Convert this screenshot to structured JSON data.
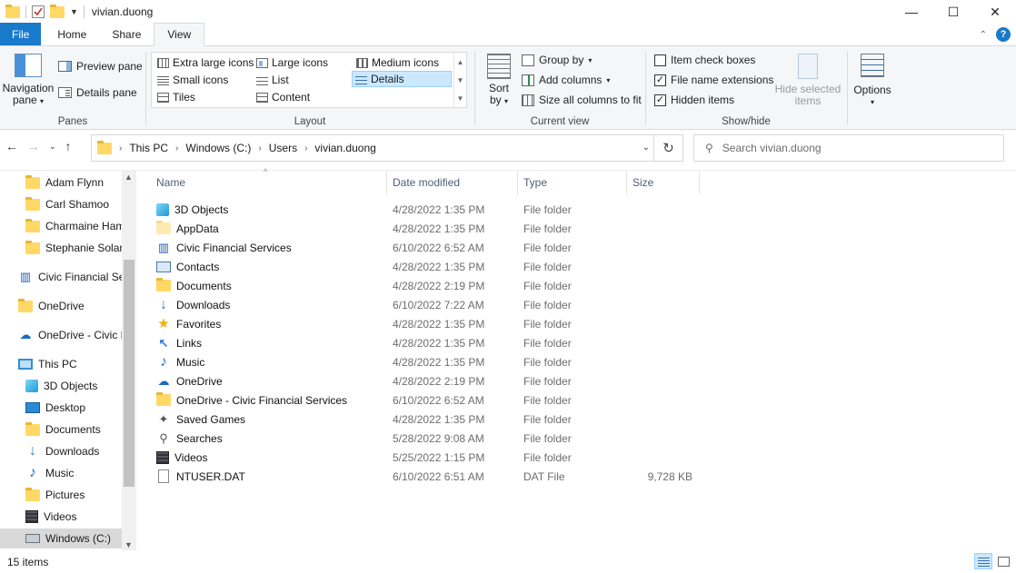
{
  "window": {
    "title": "vivian.duong",
    "minimize": "—",
    "maximize": "☐",
    "close": "✕"
  },
  "tabs": [
    {
      "label": "File"
    },
    {
      "label": "Home"
    },
    {
      "label": "Share"
    },
    {
      "label": "View"
    }
  ],
  "ribbon": {
    "panes": {
      "navigation_pane": "Navigation",
      "navigation_pane_2": "pane",
      "preview_pane": "Preview pane",
      "details_pane": "Details pane",
      "label": "Panes"
    },
    "layout": {
      "extra_large_icons": "Extra large icons",
      "large_icons": "Large icons",
      "medium_icons": "Medium icons",
      "small_icons": "Small icons",
      "list": "List",
      "details": "Details",
      "tiles": "Tiles",
      "content": "Content",
      "label": "Layout"
    },
    "current_view": {
      "sort": "Sort",
      "sort_by": "by",
      "group_by": "Group by",
      "add_columns": "Add columns",
      "size_all_columns": "Size all columns to fit",
      "label": "Current view"
    },
    "show_hide": {
      "item_check_boxes": "Item check boxes",
      "file_name_extensions": "File name extensions",
      "hidden_items": "Hidden items",
      "hide_selected": "Hide selected",
      "items": "items",
      "label": "Show/hide"
    },
    "options": "Options"
  },
  "address": {
    "crumbs": [
      "This PC",
      "Windows (C:)",
      "Users",
      "vivian.duong"
    ],
    "search_placeholder": "Search vivian.duong"
  },
  "nav": [
    {
      "label": "Adam Flynn",
      "icon": "folder"
    },
    {
      "label": "Carl Shamoo",
      "icon": "folder"
    },
    {
      "label": "Charmaine Ham",
      "icon": "folder"
    },
    {
      "label": "Stephanie Solare",
      "icon": "folder"
    },
    {
      "label": "Civic Financial Ser",
      "icon": "building"
    },
    {
      "label": "OneDrive",
      "icon": "folder"
    },
    {
      "label": "OneDrive - Civic F",
      "icon": "cloud"
    },
    {
      "label": "This PC",
      "icon": "pc"
    },
    {
      "label": "3D Objects",
      "icon": "cube"
    },
    {
      "label": "Desktop",
      "icon": "desktop"
    },
    {
      "label": "Documents",
      "icon": "documents"
    },
    {
      "label": "Downloads",
      "icon": "download"
    },
    {
      "label": "Music",
      "icon": "music"
    },
    {
      "label": "Pictures",
      "icon": "pictures"
    },
    {
      "label": "Videos",
      "icon": "videos"
    },
    {
      "label": "Windows (C:)",
      "icon": "drive"
    }
  ],
  "columns": {
    "name": "Name",
    "date": "Date modified",
    "type": "Type",
    "size": "Size"
  },
  "files": [
    {
      "name": "3D Objects",
      "date": "4/28/2022 1:35 PM",
      "type": "File folder",
      "size": "",
      "icon": "cube"
    },
    {
      "name": "AppData",
      "date": "4/28/2022 1:35 PM",
      "type": "File folder",
      "size": "",
      "icon": "folder-faded"
    },
    {
      "name": "Civic Financial Services",
      "date": "6/10/2022 6:52 AM",
      "type": "File folder",
      "size": "",
      "icon": "building"
    },
    {
      "name": "Contacts",
      "date": "4/28/2022 1:35 PM",
      "type": "File folder",
      "size": "",
      "icon": "contacts"
    },
    {
      "name": "Documents",
      "date": "4/28/2022 2:19 PM",
      "type": "File folder",
      "size": "",
      "icon": "folder"
    },
    {
      "name": "Downloads",
      "date": "6/10/2022 7:22 AM",
      "type": "File folder",
      "size": "",
      "icon": "download"
    },
    {
      "name": "Favorites",
      "date": "4/28/2022 1:35 PM",
      "type": "File folder",
      "size": "",
      "icon": "star"
    },
    {
      "name": "Links",
      "date": "4/28/2022 1:35 PM",
      "type": "File folder",
      "size": "",
      "icon": "link"
    },
    {
      "name": "Music",
      "date": "4/28/2022 1:35 PM",
      "type": "File folder",
      "size": "",
      "icon": "music"
    },
    {
      "name": "OneDrive",
      "date": "4/28/2022 2:19 PM",
      "type": "File folder",
      "size": "",
      "icon": "cloud"
    },
    {
      "name": "OneDrive - Civic Financial Services",
      "date": "6/10/2022 6:52 AM",
      "type": "File folder",
      "size": "",
      "icon": "folder"
    },
    {
      "name": "Saved Games",
      "date": "4/28/2022 1:35 PM",
      "type": "File folder",
      "size": "",
      "icon": "games"
    },
    {
      "name": "Searches",
      "date": "5/28/2022 9:08 AM",
      "type": "File folder",
      "size": "",
      "icon": "search"
    },
    {
      "name": "Videos",
      "date": "5/25/2022 1:15 PM",
      "type": "File folder",
      "size": "",
      "icon": "videos"
    },
    {
      "name": "NTUSER.DAT",
      "date": "6/10/2022 6:51 AM",
      "type": "DAT File",
      "size": "9,728 KB",
      "icon": "file"
    }
  ],
  "status": {
    "count": "15 items"
  }
}
